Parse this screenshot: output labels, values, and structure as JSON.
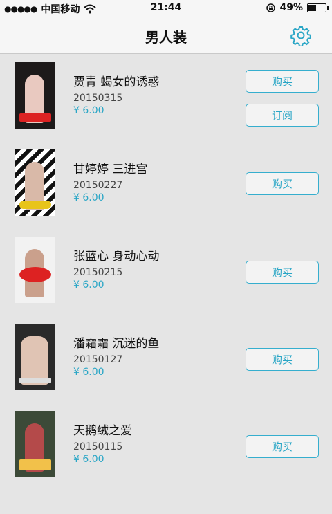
{
  "status_bar": {
    "carrier": "中国移动",
    "time": "21:44",
    "battery": "49%",
    "battery_level": 0.49
  },
  "nav": {
    "title": "男人装",
    "settings_icon": "gear-icon"
  },
  "accent_color": "#2aa6c6",
  "items": [
    {
      "title": "贾青 蝎女的诱惑",
      "date": "20150315",
      "price": "¥ 6.00",
      "buy_label": "购买",
      "subscribe_label": "订阅"
    },
    {
      "title": "甘婷婷 三进宫",
      "date": "20150227",
      "price": "¥ 6.00",
      "buy_label": "购买"
    },
    {
      "title": "张蓝心 身动心动",
      "date": "20150215",
      "price": "¥ 6.00",
      "buy_label": "购买"
    },
    {
      "title": "潘霜霜 沉迷的鱼",
      "date": "20150127",
      "price": "¥ 6.00",
      "buy_label": "购买"
    },
    {
      "title": "天鹅绒之爱",
      "date": "20150115",
      "price": "¥ 6.00",
      "buy_label": "购买"
    }
  ]
}
